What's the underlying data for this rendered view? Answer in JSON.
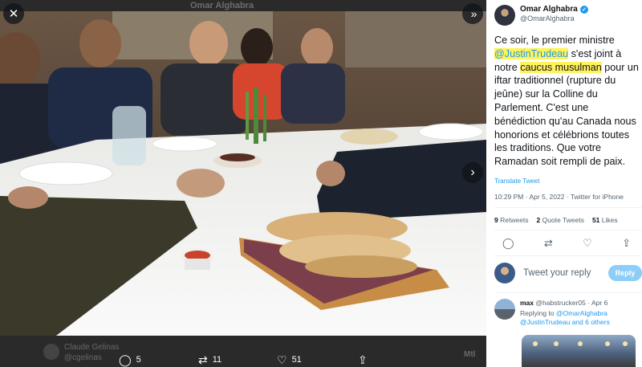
{
  "viewer": {
    "header_name": "Omar Alghabra",
    "ghost_user": "Claude Gelinas",
    "ghost_handle": "@cgelinas",
    "ghost_right": "Mtl",
    "stats": {
      "replies": "5",
      "retweets": "11",
      "likes": "51"
    }
  },
  "tweet": {
    "author_name": "Omar Alghabra",
    "author_handle": "@OmarAlghabra",
    "text_1": "Ce soir, le premier ministre ",
    "mention": "@JustinTrudeau",
    "text_2": " s'est joint à notre ",
    "highlight": "caucus musulman",
    "text_3": " pour un iftar traditionnel (rupture du jeûne) sur la Colline du Parlement. C'est une bénédiction qu'au Canada nous honorions et célébrions toutes les traditions. Que votre Ramadan soit rempli de paix.",
    "translate_label": "Translate Tweet",
    "time": "10:29 PM · Apr 5, 2022",
    "source": "Twitter for iPhone",
    "retweets_count": "9",
    "retweets_label": "Retweets",
    "quotes_count": "2",
    "quotes_label": "Quote Tweets",
    "likes_count": "51",
    "likes_label": "Likes"
  },
  "compose": {
    "placeholder": "Tweet your reply",
    "button": "Reply"
  },
  "reply": {
    "name": "max",
    "handle": "@habstrucker05",
    "date": "Apr 6",
    "replying_to": "Replying to",
    "replying_handle_1": "@OmarAlghabra",
    "replying_handle_2": "@JustinTrudeau",
    "replying_others": "and 6 others"
  },
  "icons": {
    "close": "close-icon",
    "expand": "expand-icon",
    "next": "arrow-right-icon",
    "reply": "reply-icon",
    "retweet": "retweet-icon",
    "like": "heart-icon",
    "share": "share-icon",
    "verified": "verified-badge-icon"
  },
  "colors": {
    "accent": "#1d9bf0",
    "highlight": "#fff35c",
    "reply_button": "#8ecdf7"
  }
}
